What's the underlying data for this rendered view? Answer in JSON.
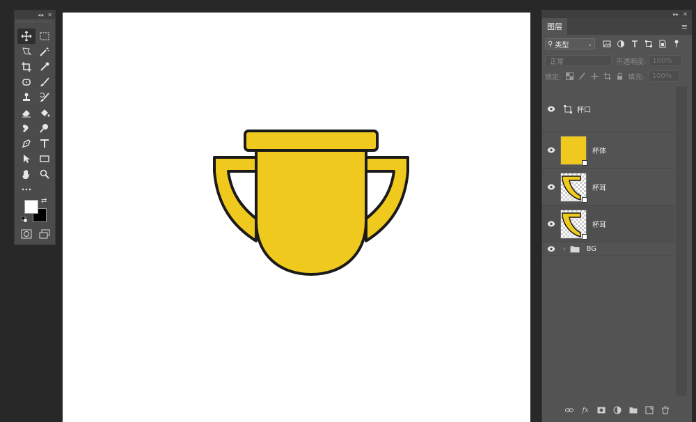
{
  "toolbox": {
    "collapse_icon": "double-chevron-left-icon",
    "close_icon": "close-icon",
    "tools": [
      {
        "name": "move-tool",
        "icon": "move-icon",
        "active": true
      },
      {
        "name": "marquee-tool",
        "icon": "rect-marquee-icon"
      },
      {
        "name": "lasso-tool",
        "icon": "lasso-icon"
      },
      {
        "name": "magic-wand-tool",
        "icon": "magic-wand-icon"
      },
      {
        "name": "crop-tool",
        "icon": "crop-icon"
      },
      {
        "name": "eyedropper-tool",
        "icon": "eyedropper-icon"
      },
      {
        "name": "healing-tool",
        "icon": "healing-icon"
      },
      {
        "name": "brush-tool",
        "icon": "brush-icon"
      },
      {
        "name": "stamp-tool",
        "icon": "stamp-icon"
      },
      {
        "name": "history-brush-tool",
        "icon": "history-brush-icon"
      },
      {
        "name": "eraser-tool",
        "icon": "eraser-icon"
      },
      {
        "name": "paint-bucket-tool",
        "icon": "paint-bucket-icon"
      },
      {
        "name": "smudge-tool",
        "icon": "smudge-icon"
      },
      {
        "name": "dodge-tool",
        "icon": "dodge-icon"
      },
      {
        "name": "pen-tool",
        "icon": "pen-icon"
      },
      {
        "name": "type-tool",
        "icon": "type-icon"
      },
      {
        "name": "path-select-tool",
        "icon": "arrow-icon"
      },
      {
        "name": "rectangle-tool",
        "icon": "rectangle-icon"
      },
      {
        "name": "hand-tool",
        "icon": "hand-icon"
      },
      {
        "name": "zoom-tool",
        "icon": "zoom-icon"
      },
      {
        "name": "more-tools",
        "icon": "ellipsis-icon"
      }
    ],
    "foreground_color": "#ffffff",
    "background_color": "#000000"
  },
  "canvas": {
    "background": "#ffffff",
    "artwork": "trophy",
    "trophy_fill": "#f0c91e",
    "outline": "#1a1a1a"
  },
  "layers_panel": {
    "tab_label": "图层",
    "menu_icon": "hamburger-icon",
    "filter_kind": "类型",
    "filter_icons": [
      "image-filter-icon",
      "adjustment-filter-icon",
      "type-filter-icon",
      "shape-filter-icon",
      "smart-object-filter-icon"
    ],
    "blend_mode": "正常",
    "opacity_label": "不透明度:",
    "opacity_value": "100%",
    "lock_label": "锁定:",
    "fill_label": "填充:",
    "fill_value": "100%",
    "layers": [
      {
        "name": "杯口",
        "type": "shape",
        "visible": true
      },
      {
        "name": "杯体",
        "type": "pixel",
        "visible": true
      },
      {
        "name": "杯耳",
        "type": "pixel",
        "visible": true
      },
      {
        "name": "杯耳",
        "type": "pixel",
        "visible": true
      },
      {
        "name": "BG",
        "type": "group",
        "visible": true
      }
    ],
    "bottom_icons": [
      "link-icon",
      "fx-icon",
      "mask-icon",
      "adjustment-icon",
      "folder-icon",
      "new-layer-icon",
      "trash-icon"
    ]
  }
}
